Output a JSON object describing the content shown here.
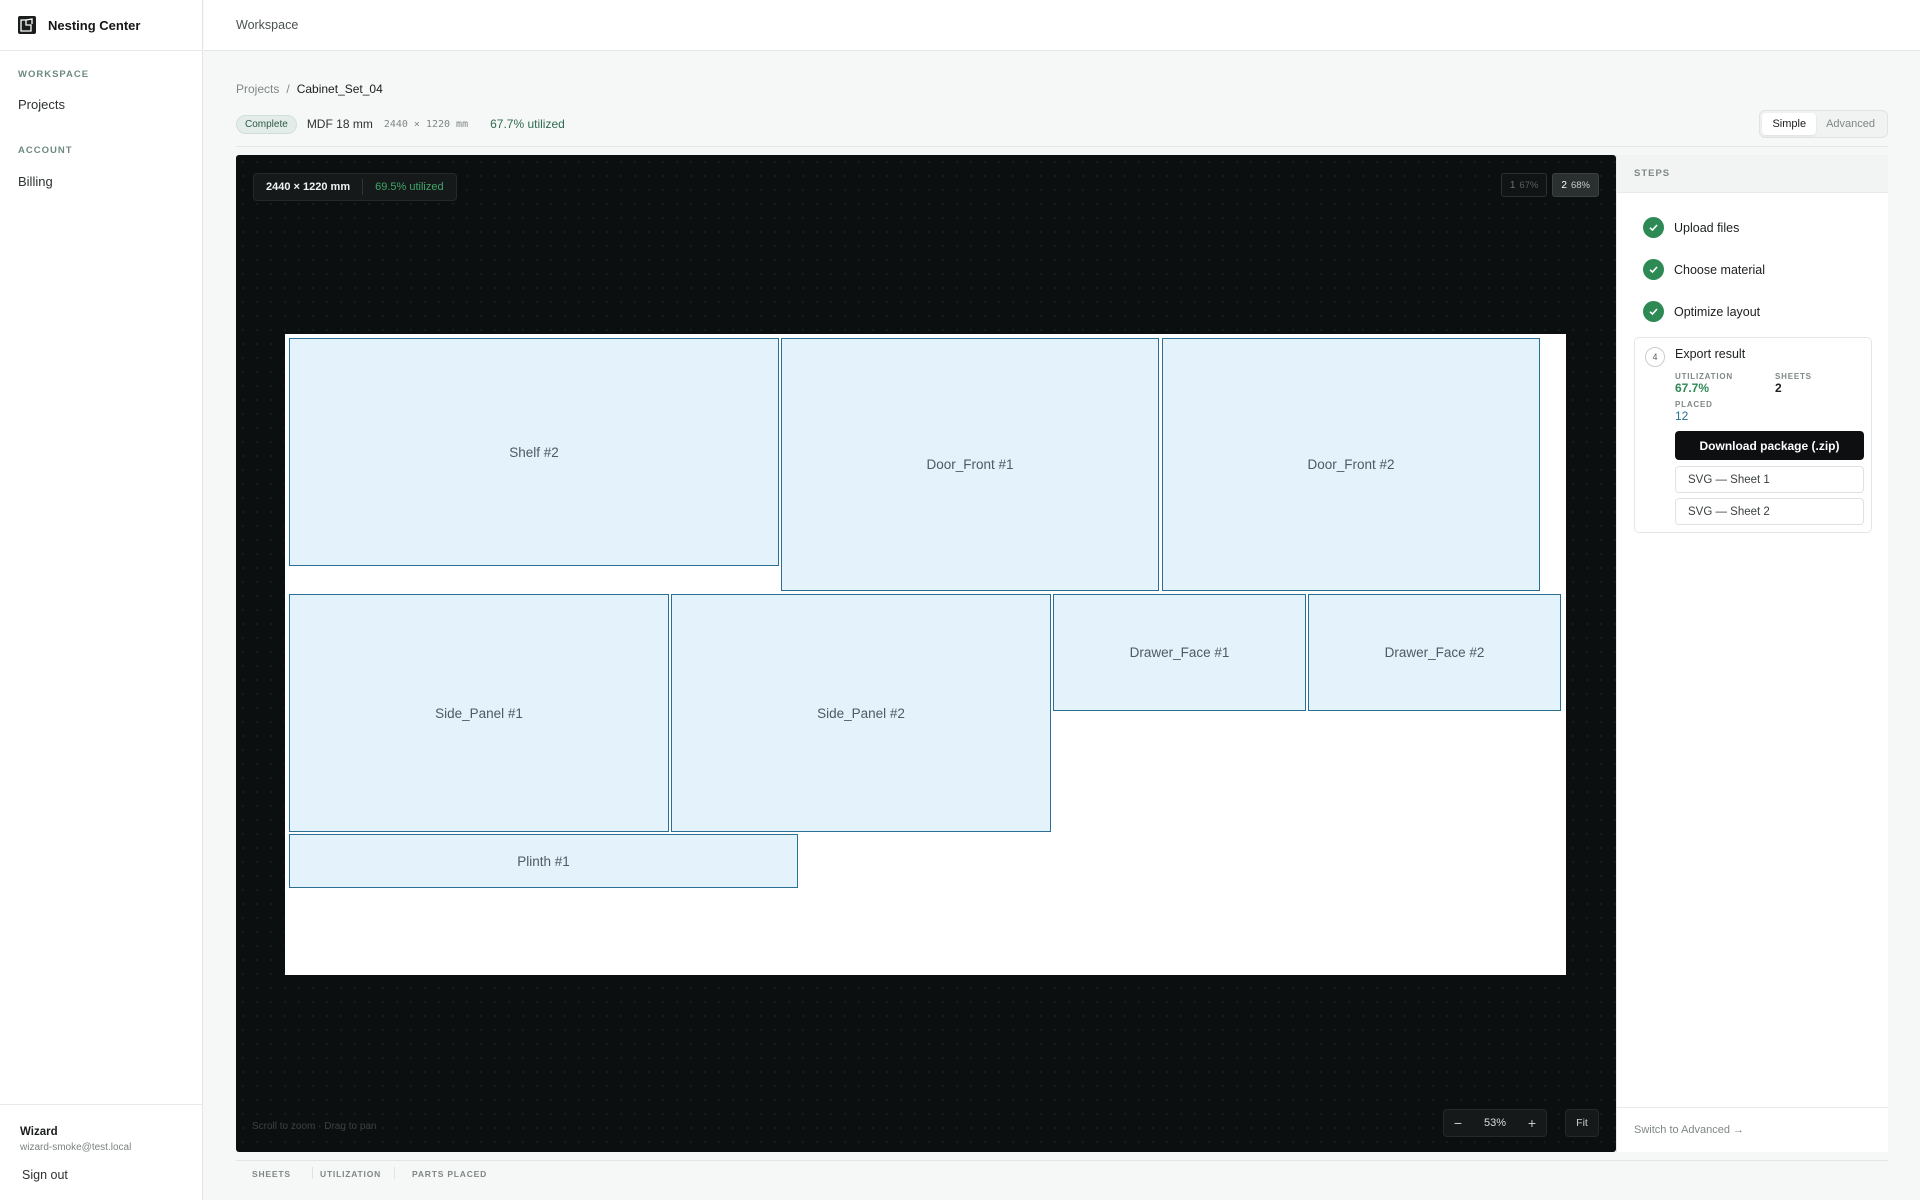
{
  "brand": {
    "name": "Nesting Center"
  },
  "nav": {
    "sections": [
      {
        "title": "WORKSPACE",
        "items": [
          "Projects"
        ]
      },
      {
        "title": "ACCOUNT",
        "items": [
          "Billing"
        ]
      }
    ]
  },
  "user": {
    "name": "Wizard",
    "email": "wizard-smoke@test.local",
    "signout": "Sign out"
  },
  "topbar": {
    "title": "Workspace"
  },
  "breadcrumb": {
    "root": "Projects",
    "separator": "/",
    "current": "Cabinet_Set_04"
  },
  "meta": {
    "status": "Complete",
    "material": "MDF 18 mm",
    "dims": "2440 × 1220 mm",
    "utilization": "67.7% utilized"
  },
  "mode": {
    "simple": "Simple",
    "advanced": "Advanced"
  },
  "canvas": {
    "sheet_dims": "2440 × 1220 mm",
    "sheet_util": "69.5% utilized",
    "tabs": [
      {
        "num": "1",
        "pct": "67%"
      },
      {
        "num": "2",
        "pct": "68%"
      }
    ],
    "hint": "Scroll to zoom · Drag to pan",
    "zoom": "53%",
    "zoom_out": "−",
    "zoom_in": "+",
    "fit": "Fit"
  },
  "parts": [
    {
      "label": "Shelf #2"
    },
    {
      "label": "Door_Front #1"
    },
    {
      "label": "Door_Front #2"
    },
    {
      "label": "Side_Panel #1"
    },
    {
      "label": "Side_Panel #2"
    },
    {
      "label": "Drawer_Face #1"
    },
    {
      "label": "Drawer_Face #2"
    },
    {
      "label": "Plinth #1"
    }
  ],
  "steps": {
    "header": "STEPS",
    "items": [
      "Upload files",
      "Choose material",
      "Optimize layout"
    ],
    "export": {
      "num": "4",
      "title": "Export result",
      "utilization_label": "UTILIZATION",
      "utilization": "67.7%",
      "sheets_label": "SHEETS",
      "sheets": "2",
      "placed_label": "PLACED",
      "placed": "12",
      "download": "Download package (.zip)",
      "svg1": "SVG — Sheet 1",
      "svg2": "SVG — Sheet 2"
    },
    "footer": "Switch to Advanced →"
  },
  "bottom": {
    "sheets": "SHEETS",
    "utilization": "UTILIZATION",
    "parts_placed": "PARTS PLACED"
  },
  "colors": {
    "accent_green": "#2e8a55",
    "part_fill": "#e4f2fb",
    "part_border": "#2b6f95",
    "canvas_bg": "#0c0f10"
  }
}
